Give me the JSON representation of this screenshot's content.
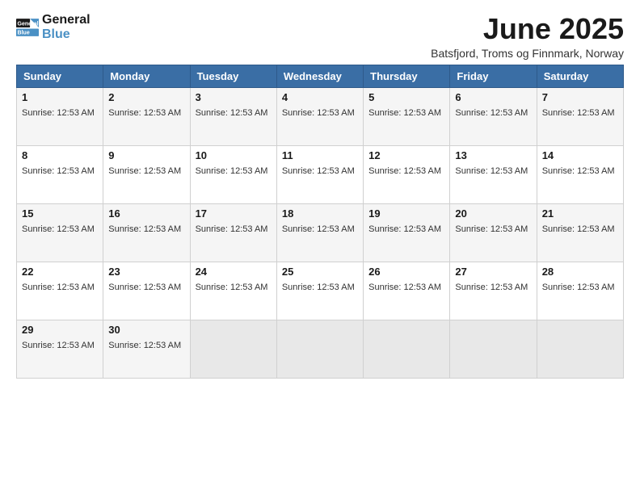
{
  "logo": {
    "line1": "General",
    "line2": "Blue"
  },
  "header": {
    "month_title": "June 2025",
    "location": "Batsfjord, Troms og Finnmark, Norway"
  },
  "days_of_week": [
    "Sunday",
    "Monday",
    "Tuesday",
    "Wednesday",
    "Thursday",
    "Friday",
    "Saturday"
  ],
  "sunrise_time": "12:53 AM",
  "weeks": [
    [
      {
        "day": "1",
        "sunrise": "Sunrise: 12:53 AM"
      },
      {
        "day": "2",
        "sunrise": "Sunrise: 12:53 AM"
      },
      {
        "day": "3",
        "sunrise": "Sunrise: 12:53 AM"
      },
      {
        "day": "4",
        "sunrise": "Sunrise: 12:53 AM"
      },
      {
        "day": "5",
        "sunrise": "Sunrise: 12:53 AM"
      },
      {
        "day": "6",
        "sunrise": "Sunrise: 12:53 AM"
      },
      {
        "day": "7",
        "sunrise": "Sunrise: 12:53 AM"
      }
    ],
    [
      {
        "day": "8",
        "sunrise": "Sunrise: 12:53 AM"
      },
      {
        "day": "9",
        "sunrise": "Sunrise: 12:53 AM"
      },
      {
        "day": "10",
        "sunrise": "Sunrise: 12:53 AM"
      },
      {
        "day": "11",
        "sunrise": "Sunrise: 12:53 AM"
      },
      {
        "day": "12",
        "sunrise": "Sunrise: 12:53 AM"
      },
      {
        "day": "13",
        "sunrise": "Sunrise: 12:53 AM"
      },
      {
        "day": "14",
        "sunrise": "Sunrise: 12:53 AM"
      }
    ],
    [
      {
        "day": "15",
        "sunrise": "Sunrise: 12:53 AM"
      },
      {
        "day": "16",
        "sunrise": "Sunrise: 12:53 AM"
      },
      {
        "day": "17",
        "sunrise": "Sunrise: 12:53 AM"
      },
      {
        "day": "18",
        "sunrise": "Sunrise: 12:53 AM"
      },
      {
        "day": "19",
        "sunrise": "Sunrise: 12:53 AM"
      },
      {
        "day": "20",
        "sunrise": "Sunrise: 12:53 AM"
      },
      {
        "day": "21",
        "sunrise": "Sunrise: 12:53 AM"
      }
    ],
    [
      {
        "day": "22",
        "sunrise": "Sunrise: 12:53 AM"
      },
      {
        "day": "23",
        "sunrise": "Sunrise: 12:53 AM"
      },
      {
        "day": "24",
        "sunrise": "Sunrise: 12:53 AM"
      },
      {
        "day": "25",
        "sunrise": "Sunrise: 12:53 AM"
      },
      {
        "day": "26",
        "sunrise": "Sunrise: 12:53 AM"
      },
      {
        "day": "27",
        "sunrise": "Sunrise: 12:53 AM"
      },
      {
        "day": "28",
        "sunrise": "Sunrise: 12:53 AM"
      }
    ],
    [
      {
        "day": "29",
        "sunrise": "Sunrise: 12:53 AM"
      },
      {
        "day": "30",
        "sunrise": "Sunrise: 12:53 AM"
      },
      null,
      null,
      null,
      null,
      null
    ]
  ]
}
